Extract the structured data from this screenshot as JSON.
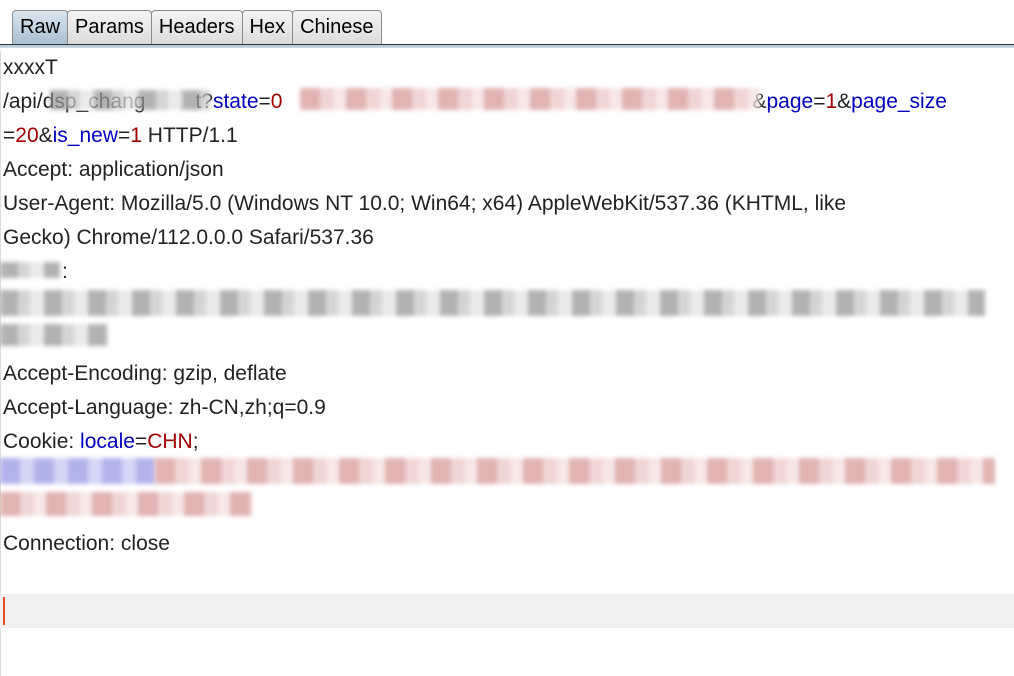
{
  "tabs": [
    {
      "label": "Raw",
      "selected": true
    },
    {
      "label": "Params"
    },
    {
      "label": "Headers"
    },
    {
      "label": "Hex"
    },
    {
      "label": "Chinese"
    }
  ],
  "request": {
    "line1": "xxxxT",
    "path_prefix": "/api/dsp_chang",
    "path_suffix": "t?",
    "p1_key": "state",
    "p1_eq": "=",
    "p1_val": "0",
    "amp": "&",
    "p2_key": "page",
    "p2_val": "1",
    "p3_key": "page_size",
    "p3_val": "20",
    "p4_key": "is_new",
    "p4_val": "1",
    "proto": " HTTP/1.1",
    "eq": "=",
    "accept": "Accept: application/json",
    "ua1": "User-Agent: Mozilla/5.0 (Windows NT 10.0; Win64; x64) AppleWebKit/537.36 (KHTML, like",
    "ua2": "Gecko) Chrome/112.0.0.0 Safari/537.36",
    "redacted_header_colon": ":",
    "accept_encoding": "Accept-Encoding: gzip, deflate",
    "accept_language": "Accept-Language: zh-CN,zh;q=0.9",
    "cookie_label": "Cookie: ",
    "cookie_key": "locale",
    "cookie_val": "CHN",
    "semi": ";",
    "connection": "Connection: close"
  },
  "colors": {
    "param_key": "#0000c0",
    "param_value": "#a00000",
    "selected_tab": "#a9bfd1",
    "caret": "#e05020"
  }
}
